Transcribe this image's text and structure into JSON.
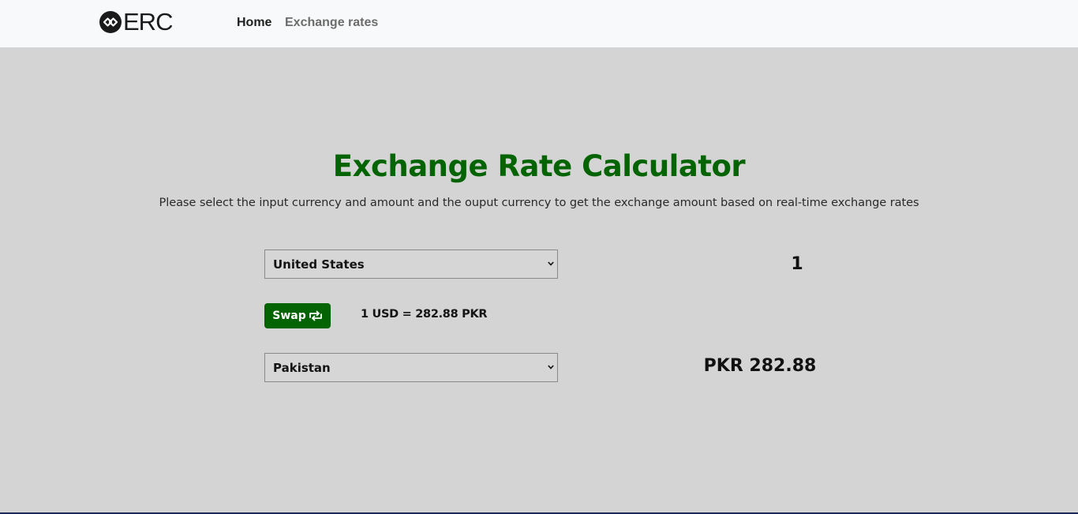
{
  "nav": {
    "logo_text": "ERC",
    "links": [
      {
        "label": "Home"
      },
      {
        "label": "Exchange rates"
      }
    ]
  },
  "main": {
    "title": "Exchange Rate Calculator",
    "subtitle": "Please select the input currency and amount and the ouput currency to get the exchange amount based on real-time exchange rates",
    "from_country": "United States",
    "amount": "1",
    "swap_label": "Swap",
    "rate_text": "1 USD = 282.88 PKR",
    "to_country": "Pakistan",
    "result": "PKR 282.88"
  },
  "colors": {
    "accent": "#046404",
    "background": "#d4d4d4",
    "navbar": "#f8f9fa"
  },
  "icons": {
    "logo": "interlocking-circle-logo-icon",
    "swap": "swap-arrows-icon",
    "dropdown": "chevron-down-icon"
  }
}
